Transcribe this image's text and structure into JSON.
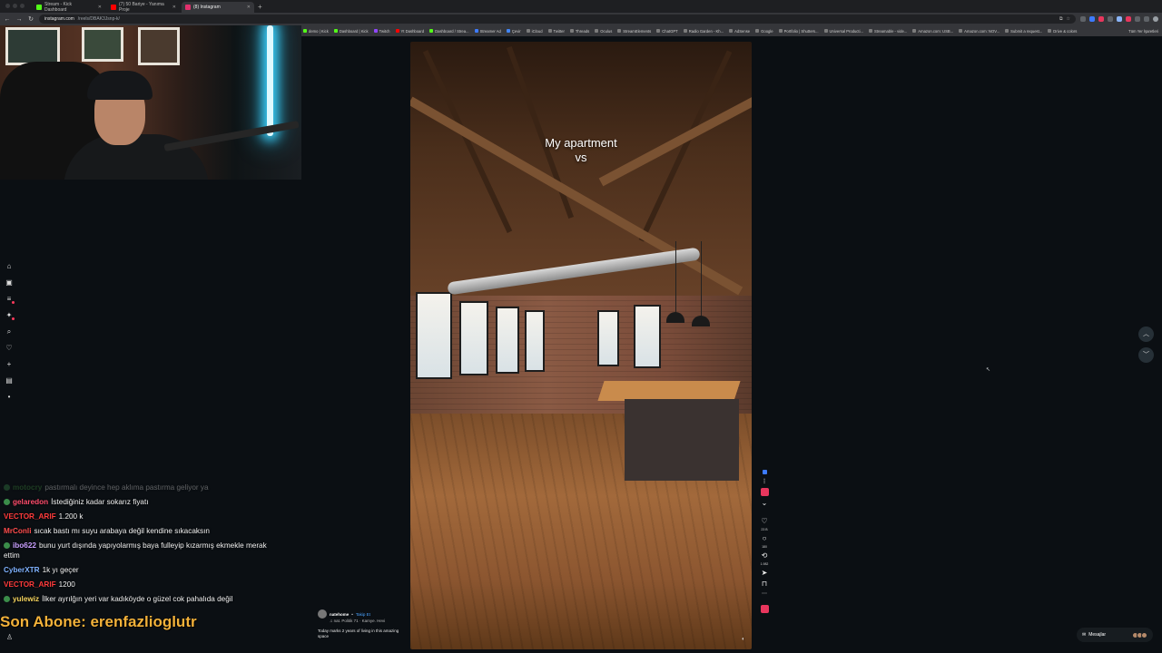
{
  "browser": {
    "tabs": [
      {
        "label": "Stream - Kick Dashboard",
        "color": "#53fc18",
        "active": false
      },
      {
        "label": "(7) 50 Bariye - Yanıma Proje",
        "color": "#ff0000",
        "active": false
      },
      {
        "label": "(8) Instagram",
        "color": "#e1306c",
        "active": true
      }
    ],
    "url_host": "instagram.com",
    "url_path": "/reels/DBAK3Jsnp-k/",
    "bookmarks": [
      "demo | Kick",
      "Dashboard | Kick",
      "Twitch",
      "Yt Dashboard",
      "Dashboard / Strea...",
      "Streamer Ad",
      "Çevir",
      "iCloud",
      "Twitter",
      "Threads",
      "Oculus",
      "StreamElements",
      "ChatGPT",
      "Radio Garden - Kh...",
      "AdSense",
      "Google",
      "Portfolio | Shutters...",
      "Universal Producti...",
      "Streamable - vide...",
      "Amazon.com: USB...",
      "Amazon.com: NOV...",
      "Submit a request...",
      "Drive & colors"
    ],
    "all_bookmarks": "Tüm Yer İşaretleri"
  },
  "stream": {
    "chat": [
      {
        "user": "motocry",
        "user_color": "#3f8f3f",
        "message": "pastırmalı deyince hep aklıma pastırma geliyor ya",
        "faded": true,
        "badge": true
      },
      {
        "user": "gelaredon",
        "user_color": "#ff4d6d",
        "message": "İstediğiniz kadar sokarız fiyatı",
        "faded": false,
        "badge": true
      },
      {
        "user": "VECTOR_ARIF",
        "user_color": "#ff3b3b",
        "message": "1.200 k",
        "faded": false,
        "badge": false
      },
      {
        "user": "MrConli",
        "user_color": "#ff4d4d",
        "message": "sıcak bastı mı suyu arabaya değil kendine sıkacaksın",
        "faded": false,
        "badge": false
      },
      {
        "user": "ibo622",
        "user_color": "#c9a0ff",
        "message": "bunu yurt dışında yapıyolarmış baya fulleyip kızarmış ekmekle merak ettim",
        "faded": false,
        "badge": true
      },
      {
        "user": "CyberXTR",
        "user_color": "#7fb2ff",
        "message": "1k yı geçer",
        "faded": false,
        "badge": false
      },
      {
        "user": "VECTOR_ARIF",
        "user_color": "#ff3b3b",
        "message": "1200",
        "faded": false,
        "badge": false
      },
      {
        "user": "yulewiz",
        "user_color": "#f4d35e",
        "message": "İlker ayrılğın yeri var kadıköyde o güzel cok pahalıda değil",
        "faded": false,
        "badge": true
      }
    ],
    "son_abone": "Son Abone: erenfazlioglutr"
  },
  "reel": {
    "caption_line1": "My apartment",
    "caption_line2": "vs",
    "author": "natehome",
    "follow_label": "Takip Et",
    "audio": "♫ nat. Politik 71 · Kamye. Hevi",
    "description": "Today marks 2 years of living in this amazing space",
    "counts": {
      "likes": "23 B",
      "comments": "180",
      "shares": "1.982"
    }
  },
  "ui": {
    "messages_label": "Mesajlar"
  }
}
